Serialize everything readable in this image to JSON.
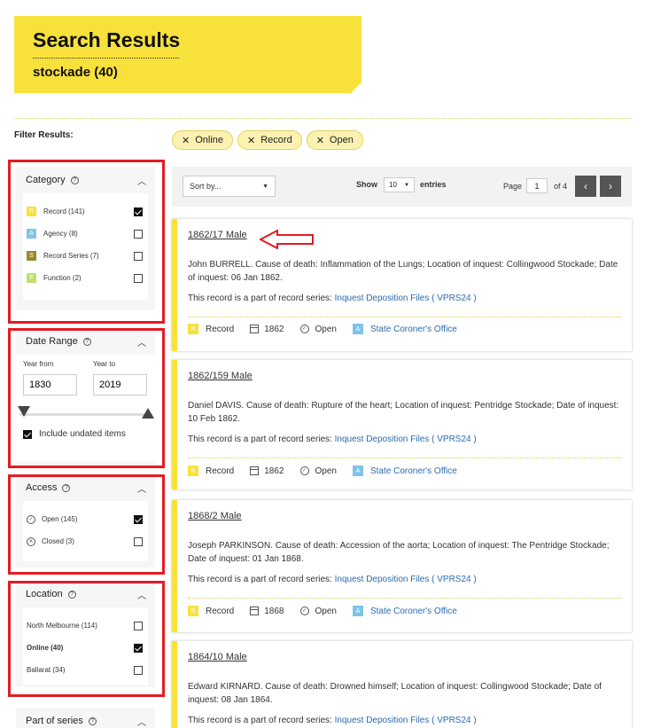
{
  "header": {
    "title": "Search Results",
    "subtitle": "stockade (40)"
  },
  "filter_label": "Filter Results:",
  "active_filters": [
    {
      "label": "Online",
      "icon": "x-icon"
    },
    {
      "label": "Record",
      "icon": "x-icon"
    },
    {
      "label": "Open",
      "icon": "x-icon"
    }
  ],
  "category": {
    "title": "Category",
    "items": [
      {
        "tag": "R",
        "tag_color": "#f9e13b",
        "label": "Record (141)",
        "checked": true
      },
      {
        "tag": "A",
        "tag_color": "#7fc3e8",
        "label": "Agency (8)",
        "checked": false
      },
      {
        "tag": "S",
        "tag_color": "#9a8a2a",
        "label": "Record Series (7)",
        "checked": false
      },
      {
        "tag": "F",
        "tag_color": "#b9e36a",
        "label": "Function (2)",
        "checked": false
      }
    ]
  },
  "date_range": {
    "title": "Date Range",
    "from_label": "Year from",
    "to_label": "Year to",
    "from_value": "1830",
    "to_value": "2019",
    "undated_label": "Include undated items",
    "undated_checked": true
  },
  "access": {
    "title": "Access",
    "items": [
      {
        "icon": "check-circle-icon",
        "label": "Open (145)",
        "checked": true
      },
      {
        "icon": "x-circle-icon",
        "label": "Closed (3)",
        "checked": false
      }
    ]
  },
  "location": {
    "title": "Location",
    "items": [
      {
        "label": "North Melbourne (114)",
        "checked": false
      },
      {
        "label": "Online (40)",
        "checked": true
      },
      {
        "label": "Ballarat (34)",
        "checked": false
      }
    ]
  },
  "part_of_series": {
    "title": "Part of series"
  },
  "toolbar": {
    "sort_placeholder": "Sort by...",
    "show_label": "Show",
    "show_value": "10",
    "entries_label": "entries",
    "page_label": "Page",
    "page_value": "1",
    "page_of": "of 4"
  },
  "results": [
    {
      "title": "1862/17 Male",
      "desc": "John BURRELL. Cause of death: Inflammation of the Lungs; Location of inquest: Collingwood Stockade; Date of inquest: 06 Jan 1862.",
      "series_prefix": "This record is a part of record series:",
      "series_link": "Inquest Deposition Files ( VPRS24 )",
      "type": "Record",
      "year": "1862",
      "access": "Open",
      "agency": "State Coroner's Office"
    },
    {
      "title": "1862/159 Male",
      "desc": "Daniel DAVIS. Cause of death: Rupture of the heart; Location of inquest: Pentridge Stockade; Date of inquest: 10 Feb 1862.",
      "series_prefix": "This record is a part of record series:",
      "series_link": "Inquest Deposition Files ( VPRS24 )",
      "type": "Record",
      "year": "1862",
      "access": "Open",
      "agency": "State Coroner's Office"
    },
    {
      "title": "1868/2 Male",
      "desc": "Joseph PARKINSON. Cause of death: Accession of the aorta; Location of inquest: The Pentridge Stockade; Date of inquest: 01 Jan 1868.",
      "series_prefix": "This record is a part of record series:",
      "series_link": "Inquest Deposition Files ( VPRS24 )",
      "type": "Record",
      "year": "1868",
      "access": "Open",
      "agency": "State Coroner's Office"
    },
    {
      "title": "1864/10 Male",
      "desc": "Edward KIRNARD. Cause of death: Drowned himself; Location of inquest: Collingwood Stockade; Date of inquest: 08 Jan 1864.",
      "series_prefix": "This record is a part of record series:",
      "series_link": "Inquest Deposition Files ( VPRS24 )"
    }
  ],
  "colors": {
    "brand_yellow": "#f9e13b",
    "highlight_red": "#e41b23",
    "link_blue": "#2b6cb0"
  }
}
